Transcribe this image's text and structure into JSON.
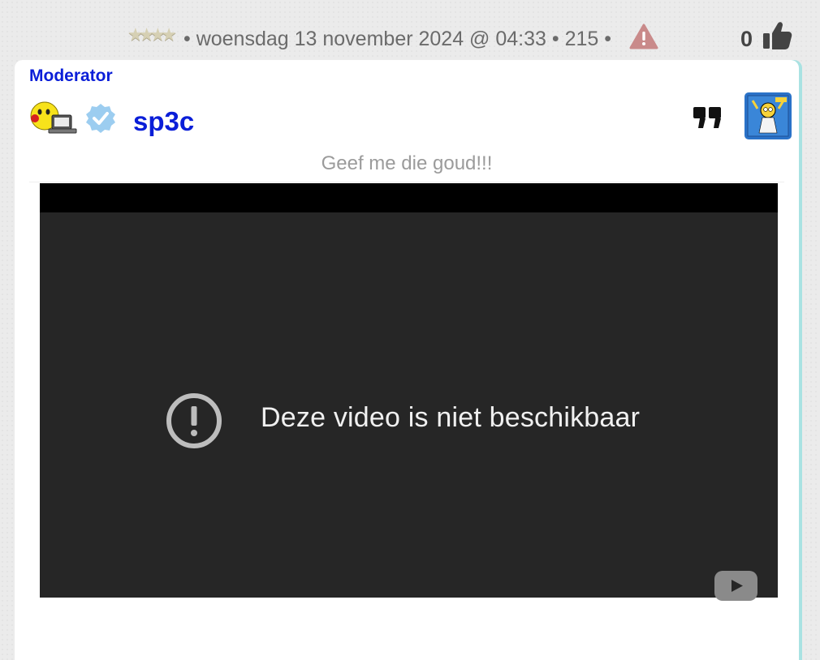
{
  "post_meta": {
    "date_text": "• woensdag 13 november 2024 @ 04:33 • 215 •",
    "likes": "0"
  },
  "post": {
    "role": "Moderator",
    "username": "sp3c",
    "tagline": "Geef me die goud!!!"
  },
  "video": {
    "message": "Deze video is niet beschikbaar"
  },
  "icons": {
    "stars": "star-rating-icon",
    "warning": "warning-icon",
    "like": "thumbs-up-icon",
    "smiley": "smiley-computer-icon",
    "verified": "verified-badge-icon",
    "quote": "quote-icon",
    "error": "error-icon",
    "youtube": "youtube-logo-icon"
  },
  "colors": {
    "username": "#0a1ed8",
    "warning": "#c98a8a",
    "card_accent": "#a9e2e2",
    "video_bg": "#262626"
  }
}
